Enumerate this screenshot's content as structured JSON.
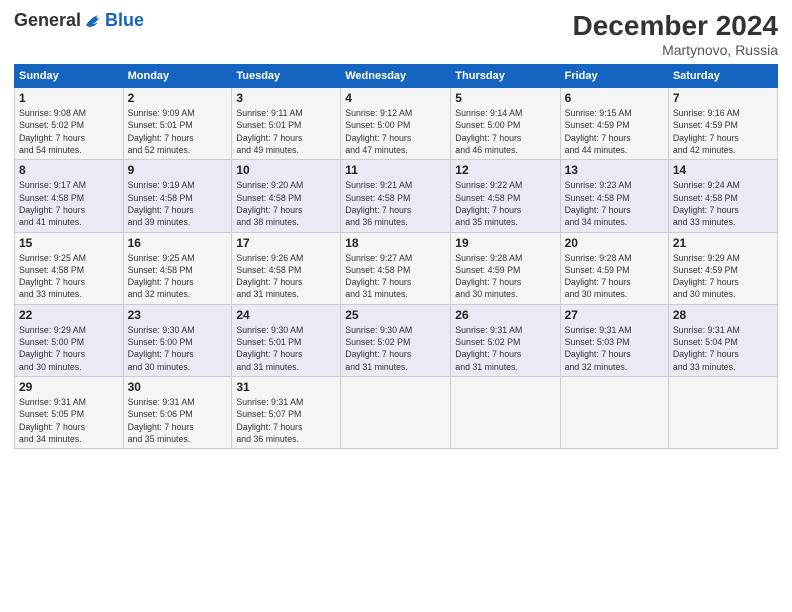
{
  "header": {
    "logo_general": "General",
    "logo_blue": "Blue",
    "month_title": "December 2024",
    "location": "Martynovo, Russia"
  },
  "weekdays": [
    "Sunday",
    "Monday",
    "Tuesday",
    "Wednesday",
    "Thursday",
    "Friday",
    "Saturday"
  ],
  "weeks": [
    [
      {
        "day": "1",
        "sunrise": "9:08 AM",
        "sunset": "5:02 PM",
        "daylight": "7 hours and 54 minutes."
      },
      {
        "day": "2",
        "sunrise": "9:09 AM",
        "sunset": "5:01 PM",
        "daylight": "7 hours and 52 minutes."
      },
      {
        "day": "3",
        "sunrise": "9:11 AM",
        "sunset": "5:01 PM",
        "daylight": "7 hours and 49 minutes."
      },
      {
        "day": "4",
        "sunrise": "9:12 AM",
        "sunset": "5:00 PM",
        "daylight": "7 hours and 47 minutes."
      },
      {
        "day": "5",
        "sunrise": "9:14 AM",
        "sunset": "5:00 PM",
        "daylight": "7 hours and 46 minutes."
      },
      {
        "day": "6",
        "sunrise": "9:15 AM",
        "sunset": "4:59 PM",
        "daylight": "7 hours and 44 minutes."
      },
      {
        "day": "7",
        "sunrise": "9:16 AM",
        "sunset": "4:59 PM",
        "daylight": "7 hours and 42 minutes."
      }
    ],
    [
      {
        "day": "8",
        "sunrise": "9:17 AM",
        "sunset": "4:58 PM",
        "daylight": "7 hours and 41 minutes."
      },
      {
        "day": "9",
        "sunrise": "9:19 AM",
        "sunset": "4:58 PM",
        "daylight": "7 hours and 39 minutes."
      },
      {
        "day": "10",
        "sunrise": "9:20 AM",
        "sunset": "4:58 PM",
        "daylight": "7 hours and 38 minutes."
      },
      {
        "day": "11",
        "sunrise": "9:21 AM",
        "sunset": "4:58 PM",
        "daylight": "7 hours and 36 minutes."
      },
      {
        "day": "12",
        "sunrise": "9:22 AM",
        "sunset": "4:58 PM",
        "daylight": "7 hours and 35 minutes."
      },
      {
        "day": "13",
        "sunrise": "9:23 AM",
        "sunset": "4:58 PM",
        "daylight": "7 hours and 34 minutes."
      },
      {
        "day": "14",
        "sunrise": "9:24 AM",
        "sunset": "4:58 PM",
        "daylight": "7 hours and 33 minutes."
      }
    ],
    [
      {
        "day": "15",
        "sunrise": "9:25 AM",
        "sunset": "4:58 PM",
        "daylight": "7 hours and 33 minutes."
      },
      {
        "day": "16",
        "sunrise": "9:25 AM",
        "sunset": "4:58 PM",
        "daylight": "7 hours and 32 minutes."
      },
      {
        "day": "17",
        "sunrise": "9:26 AM",
        "sunset": "4:58 PM",
        "daylight": "7 hours and 31 minutes."
      },
      {
        "day": "18",
        "sunrise": "9:27 AM",
        "sunset": "4:58 PM",
        "daylight": "7 hours and 31 minutes."
      },
      {
        "day": "19",
        "sunrise": "9:28 AM",
        "sunset": "4:59 PM",
        "daylight": "7 hours and 30 minutes."
      },
      {
        "day": "20",
        "sunrise": "9:28 AM",
        "sunset": "4:59 PM",
        "daylight": "7 hours and 30 minutes."
      },
      {
        "day": "21",
        "sunrise": "9:29 AM",
        "sunset": "4:59 PM",
        "daylight": "7 hours and 30 minutes."
      }
    ],
    [
      {
        "day": "22",
        "sunrise": "9:29 AM",
        "sunset": "5:00 PM",
        "daylight": "7 hours and 30 minutes."
      },
      {
        "day": "23",
        "sunrise": "9:30 AM",
        "sunset": "5:00 PM",
        "daylight": "7 hours and 30 minutes."
      },
      {
        "day": "24",
        "sunrise": "9:30 AM",
        "sunset": "5:01 PM",
        "daylight": "7 hours and 31 minutes."
      },
      {
        "day": "25",
        "sunrise": "9:30 AM",
        "sunset": "5:02 PM",
        "daylight": "7 hours and 31 minutes."
      },
      {
        "day": "26",
        "sunrise": "9:31 AM",
        "sunset": "5:02 PM",
        "daylight": "7 hours and 31 minutes."
      },
      {
        "day": "27",
        "sunrise": "9:31 AM",
        "sunset": "5:03 PM",
        "daylight": "7 hours and 32 minutes."
      },
      {
        "day": "28",
        "sunrise": "9:31 AM",
        "sunset": "5:04 PM",
        "daylight": "7 hours and 33 minutes."
      }
    ],
    [
      {
        "day": "29",
        "sunrise": "9:31 AM",
        "sunset": "5:05 PM",
        "daylight": "7 hours and 34 minutes."
      },
      {
        "day": "30",
        "sunrise": "9:31 AM",
        "sunset": "5:06 PM",
        "daylight": "7 hours and 35 minutes."
      },
      {
        "day": "31",
        "sunrise": "9:31 AM",
        "sunset": "5:07 PM",
        "daylight": "7 hours and 36 minutes."
      },
      null,
      null,
      null,
      null
    ]
  ]
}
